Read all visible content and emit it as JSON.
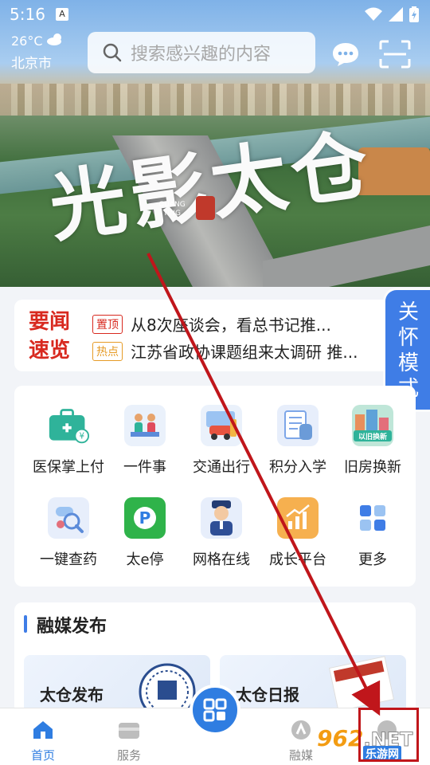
{
  "status_bar": {
    "time": "5:16",
    "notif_badge": "A"
  },
  "header": {
    "temperature": "26°C",
    "city": "北京市",
    "search_placeholder": "搜索感兴趣的内容"
  },
  "banner": {
    "calligraphy": "光影太仓",
    "seal_caption": "GUANG YING",
    "seal_label": "太仓"
  },
  "news": {
    "badge_line1": "要闻",
    "badge_line2": "速览",
    "items": [
      {
        "tag": "置顶",
        "text": "从8次座谈会，看总书记推..."
      },
      {
        "tag": "热点",
        "text": "江苏省政协课题组来太调研 推..."
      }
    ]
  },
  "care_mode": {
    "label": "关怀模式"
  },
  "services": [
    {
      "label": "医保掌上付",
      "icon": "medical-kit-icon"
    },
    {
      "label": "一件事",
      "icon": "service-counter-icon"
    },
    {
      "label": "交通出行",
      "icon": "traffic-icon"
    },
    {
      "label": "积分入学",
      "icon": "school-bag-icon"
    },
    {
      "label": "旧房换新",
      "icon": "house-renewal-icon"
    },
    {
      "label": "一键查药",
      "icon": "medicine-search-icon"
    },
    {
      "label": "太e停",
      "icon": "parking-icon"
    },
    {
      "label": "网格在线",
      "icon": "police-icon"
    },
    {
      "label": "成长平台",
      "icon": "growth-chart-icon"
    },
    {
      "label": "更多",
      "icon": "more-grid-icon"
    }
  ],
  "media": {
    "section_title": "融媒发布",
    "cards": [
      {
        "title": "太仓发布"
      },
      {
        "title": "太仓日报"
      }
    ]
  },
  "bottom_nav": {
    "items": [
      {
        "label": "首页",
        "icon": "home-icon",
        "active": true
      },
      {
        "label": "服务",
        "icon": "wallet-icon",
        "active": false
      },
      {
        "label": "",
        "icon": "scan-icon",
        "active": false
      },
      {
        "label": "融媒",
        "icon": "media-icon",
        "active": false
      },
      {
        "label": "",
        "icon": "profile-icon",
        "active": false
      }
    ]
  },
  "watermark": {
    "site": "962",
    "tld": ".NET",
    "sub": "乐游网"
  },
  "colors": {
    "primary": "#2f7de1",
    "news_red": "#d8291f",
    "hot_orange": "#e69b26",
    "annotation_red": "#c0161b"
  }
}
